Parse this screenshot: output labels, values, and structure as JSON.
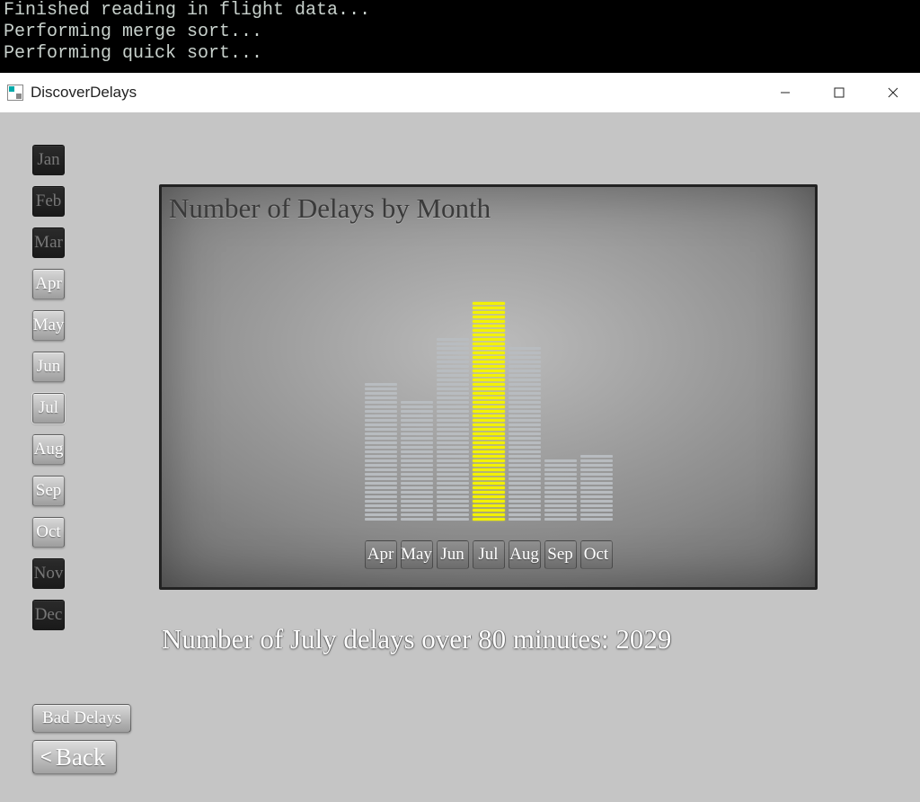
{
  "console": {
    "line1": "Finished reading in flight data...",
    "line2": "Performing merge sort...",
    "line3": "Performing quick sort..."
  },
  "window": {
    "title": "DiscoverDelays"
  },
  "months": [
    {
      "label": "Jan",
      "available": false
    },
    {
      "label": "Feb",
      "available": false
    },
    {
      "label": "Mar",
      "available": false
    },
    {
      "label": "Apr",
      "available": true
    },
    {
      "label": "May",
      "available": true
    },
    {
      "label": "Jun",
      "available": true
    },
    {
      "label": "Jul",
      "available": true,
      "selected": true
    },
    {
      "label": "Aug",
      "available": true
    },
    {
      "label": "Sep",
      "available": true
    },
    {
      "label": "Oct",
      "available": true
    },
    {
      "label": "Nov",
      "available": false
    },
    {
      "label": "Dec",
      "available": false
    }
  ],
  "chart_data": {
    "type": "bar",
    "title": "Number of Delays by Month",
    "xlabel": "",
    "ylabel": "",
    "ylim": [
      0,
      50
    ],
    "categories": [
      "Apr",
      "May",
      "Jun",
      "Jul",
      "Aug",
      "Sep",
      "Oct"
    ],
    "values": [
      31,
      27,
      41,
      49,
      39,
      14,
      15
    ],
    "highlight_index": 3
  },
  "info_text": "Number of July delays over 80 minutes: 2029",
  "buttons": {
    "bad_delays": "Bad Delays",
    "back": "Back"
  },
  "colors": {
    "bar": "#b8bcc0",
    "bar_highlight": "#f4f200",
    "panel_border": "#222222",
    "app_bg": "#c5c5c5"
  }
}
